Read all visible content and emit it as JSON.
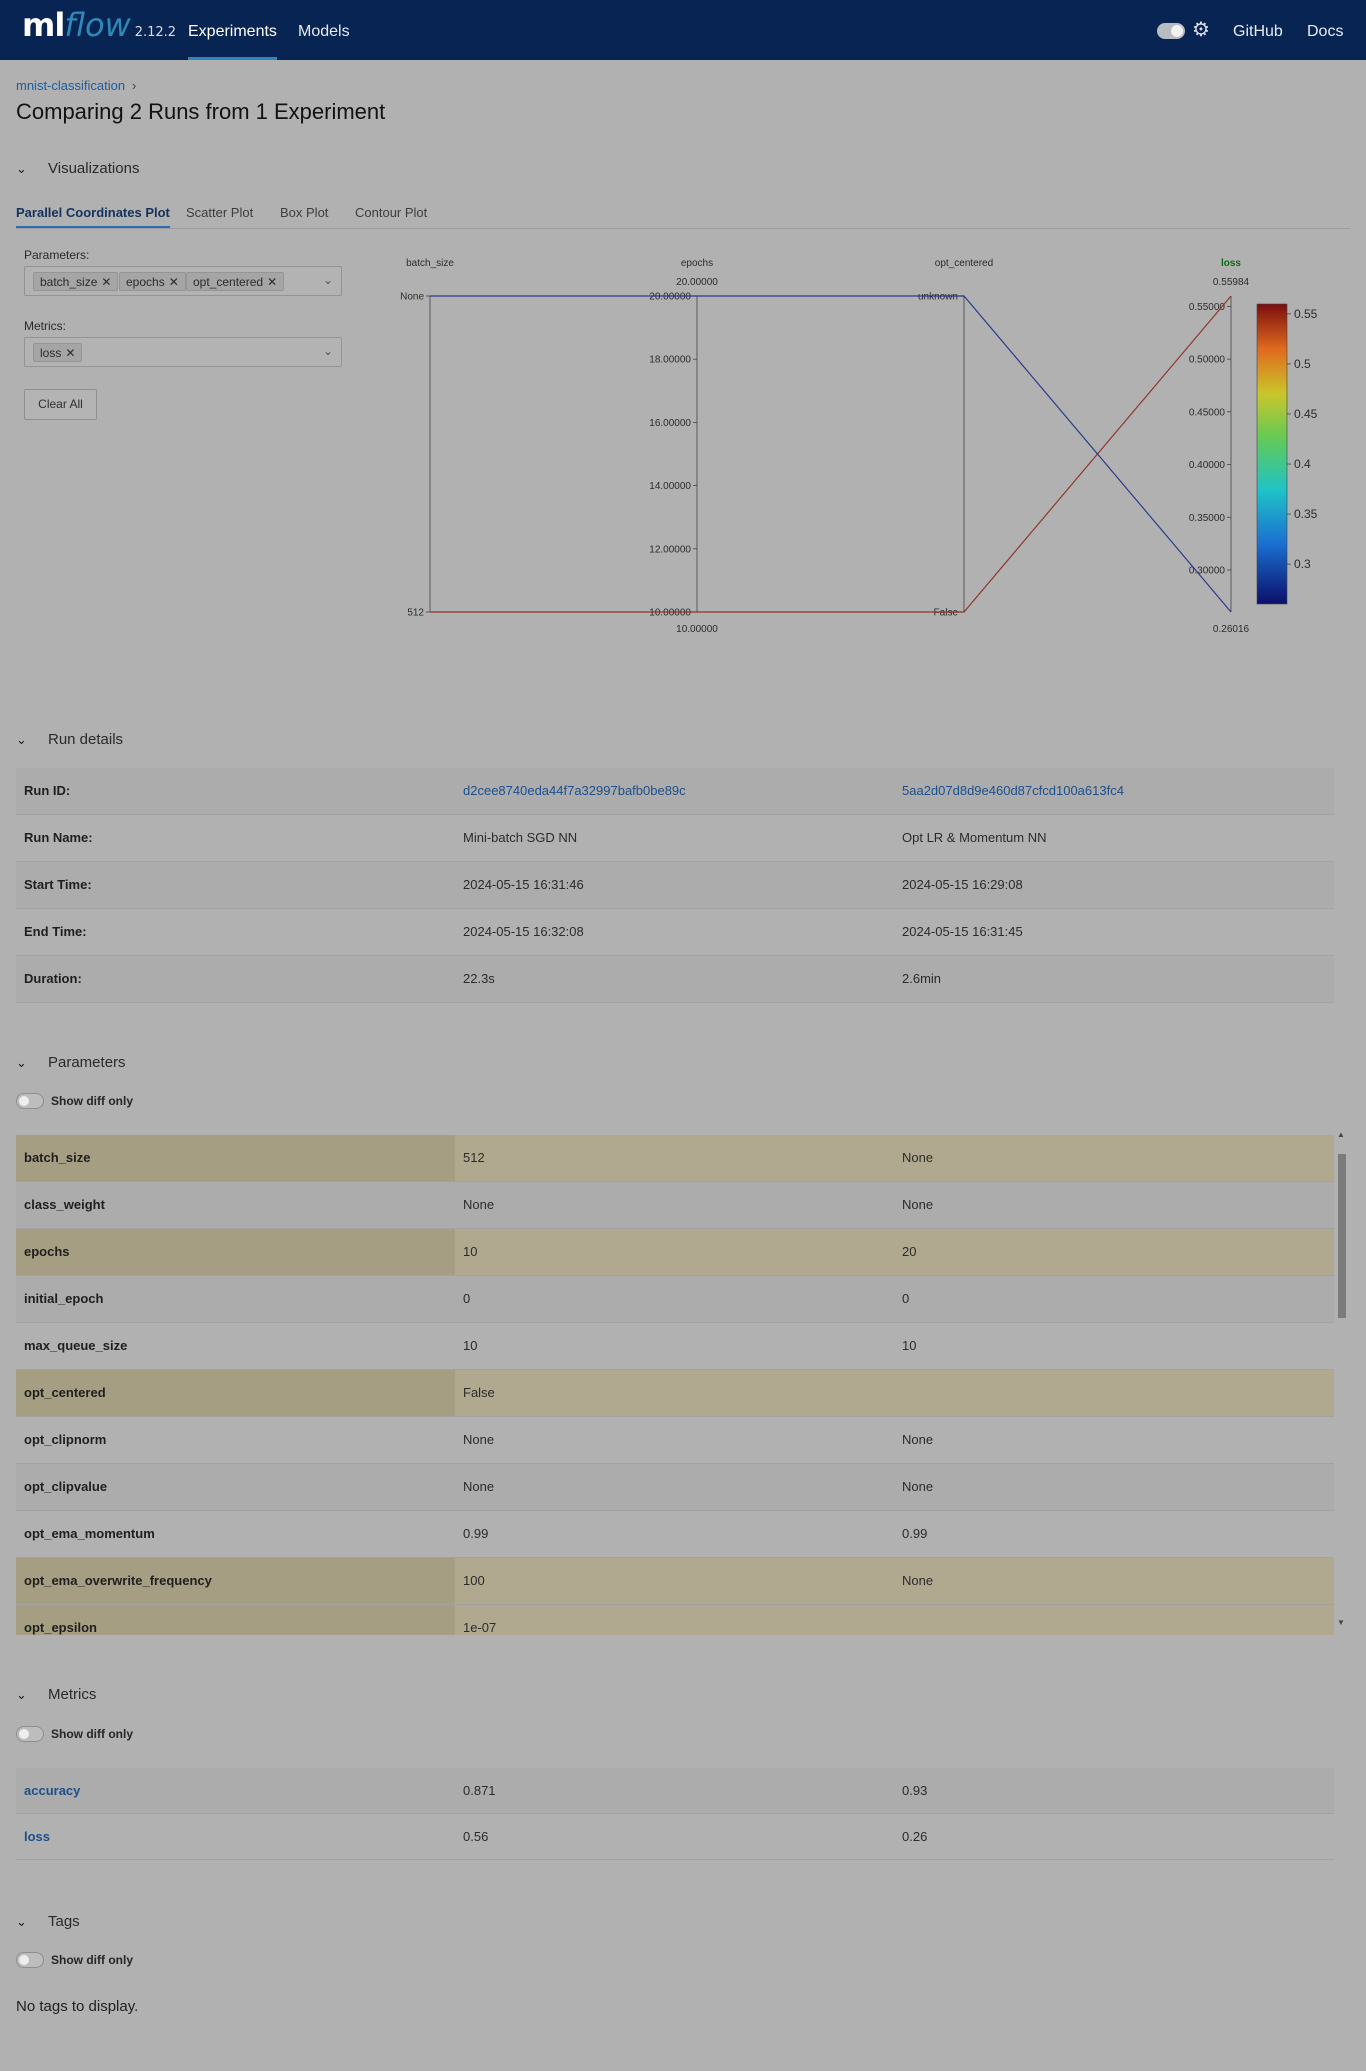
{
  "app": {
    "logo_ml": "ml",
    "logo_flow": "flow",
    "version": "2.12.2"
  },
  "nav": {
    "experiments": "Experiments",
    "models": "Models",
    "github": "GitHub",
    "docs": "Docs"
  },
  "breadcrumb": {
    "experiment": "mnist-classification",
    "separator": "›"
  },
  "page_title": "Comparing 2 Runs from 1 Experiment",
  "sections": {
    "visualizations": "Visualizations",
    "run_details": "Run details",
    "parameters": "Parameters",
    "metrics": "Metrics",
    "tags": "Tags"
  },
  "tabs": [
    "Parallel Coordinates Plot",
    "Scatter Plot",
    "Box Plot",
    "Contour Plot"
  ],
  "controls": {
    "parameters_label": "Parameters:",
    "parameters_selected": [
      "batch_size",
      "epochs",
      "opt_centered"
    ],
    "metrics_label": "Metrics:",
    "metrics_selected": [
      "loss"
    ],
    "clear_all": "Clear All"
  },
  "chart_data": {
    "type": "parallel_coordinates",
    "axes": [
      {
        "name": "batch_size",
        "kind": "categorical",
        "ticks": [
          "None",
          "512"
        ],
        "top": "None",
        "bottom": "512"
      },
      {
        "name": "epochs",
        "kind": "numeric",
        "range": [
          10,
          20
        ],
        "top_label": "20.00000",
        "bottom_label": "10.00000",
        "ticks": [
          "20.00000",
          "18.00000",
          "16.00000",
          "14.00000",
          "12.00000",
          "10.00000"
        ]
      },
      {
        "name": "opt_centered",
        "kind": "categorical",
        "ticks": [
          "unknown",
          "False"
        ]
      },
      {
        "name": "loss",
        "kind": "numeric",
        "range": [
          0.26016,
          0.55984
        ],
        "top_label": "0.55984",
        "bottom_label": "0.26016",
        "ticks": [
          "0.55000",
          "0.50000",
          "0.45000",
          "0.40000",
          "0.35000",
          "0.30000"
        ]
      }
    ],
    "lines": [
      {
        "run": "Mini-batch SGD NN",
        "batch_size": "512",
        "epochs": 10,
        "opt_centered": "False",
        "loss": 0.55984,
        "color": "#8b2a22"
      },
      {
        "run": "Opt LR & Momentum NN",
        "batch_size": "None",
        "epochs": 20,
        "opt_centered": "unknown",
        "loss": 0.26016,
        "color": "#1d2f86"
      }
    ],
    "colorscale": {
      "ticks": [
        "0.55",
        "0.5",
        "0.45",
        "0.4",
        "0.35",
        "0.3"
      ],
      "range": [
        0.26016,
        0.55984
      ]
    }
  },
  "run_details": {
    "rows": [
      {
        "label": "Run ID:",
        "a": "d2cee8740eda44f7a32997bafb0be89c",
        "b": "5aa2d07d8d9e460d87cfcd100a613fc4",
        "link": true
      },
      {
        "label": "Run Name:",
        "a": "Mini-batch SGD NN",
        "b": "Opt LR & Momentum NN"
      },
      {
        "label": "Start Time:",
        "a": "2024-05-15 16:31:46",
        "b": "2024-05-15 16:29:08"
      },
      {
        "label": "End Time:",
        "a": "2024-05-15 16:32:08",
        "b": "2024-05-15 16:31:45"
      },
      {
        "label": "Duration:",
        "a": "22.3s",
        "b": "2.6min"
      }
    ]
  },
  "show_diff_only": "Show diff only",
  "parameters": {
    "rows": [
      {
        "name": "batch_size",
        "a": "512",
        "b": "None",
        "diff": true
      },
      {
        "name": "class_weight",
        "a": "None",
        "b": "None",
        "diff": false
      },
      {
        "name": "epochs",
        "a": "10",
        "b": "20",
        "diff": true
      },
      {
        "name": "initial_epoch",
        "a": "0",
        "b": "0",
        "diff": false
      },
      {
        "name": "max_queue_size",
        "a": "10",
        "b": "10",
        "diff": false
      },
      {
        "name": "opt_centered",
        "a": "False",
        "b": "",
        "diff": true
      },
      {
        "name": "opt_clipnorm",
        "a": "None",
        "b": "None",
        "diff": false
      },
      {
        "name": "opt_clipvalue",
        "a": "None",
        "b": "None",
        "diff": false
      },
      {
        "name": "opt_ema_momentum",
        "a": "0.99",
        "b": "0.99",
        "diff": false
      },
      {
        "name": "opt_ema_overwrite_frequency",
        "a": "100",
        "b": "None",
        "diff": true
      },
      {
        "name": "opt_epsilon",
        "a": "1e-07",
        "b": "",
        "diff": true
      }
    ]
  },
  "metrics": {
    "rows": [
      {
        "name": "accuracy",
        "a": "0.871",
        "b": "0.93"
      },
      {
        "name": "loss",
        "a": "0.56",
        "b": "0.26"
      }
    ]
  },
  "tags": {
    "empty": "No tags to display."
  }
}
